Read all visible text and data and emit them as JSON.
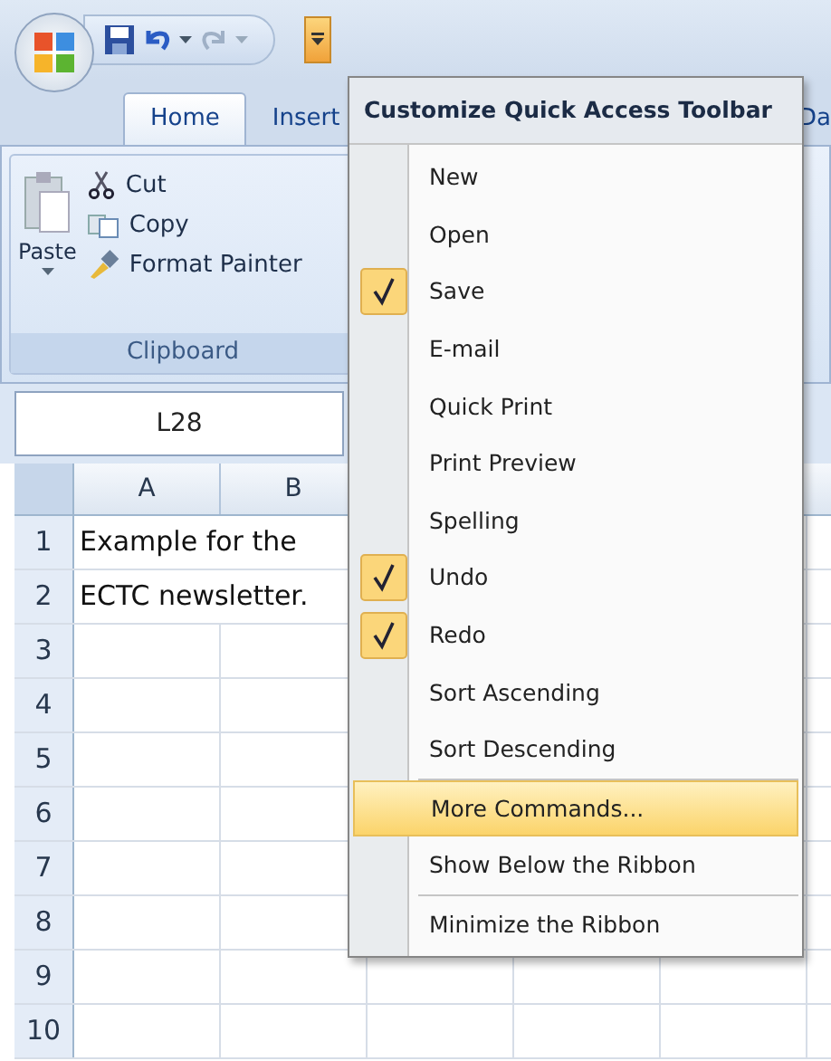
{
  "tabs": [
    {
      "label": "Home",
      "selected": true
    },
    {
      "label": "Insert",
      "selected": false
    },
    {
      "label": "Da",
      "selected": false
    }
  ],
  "clipboard": {
    "paste": "Paste",
    "commands": [
      {
        "kind": "cut",
        "label": "Cut"
      },
      {
        "kind": "copy",
        "label": "Copy"
      },
      {
        "kind": "painter",
        "label": "Format Painter"
      }
    ],
    "group": "Clipboard"
  },
  "name_box": "L28",
  "columns": [
    "A",
    "B"
  ],
  "rows": [
    {
      "number": "1",
      "cell": "Example for the"
    },
    {
      "number": "2",
      "cell": "ECTC newsletter."
    },
    {
      "number": "3"
    },
    {
      "number": "4"
    },
    {
      "number": "5"
    },
    {
      "number": "6"
    },
    {
      "number": "7"
    },
    {
      "number": "8"
    },
    {
      "number": "9"
    },
    {
      "number": "10"
    }
  ],
  "menu": {
    "title": "Customize Quick Access Toolbar",
    "items": [
      {
        "label": "New",
        "checked": false,
        "selected": false,
        "separator_before": false
      },
      {
        "label": "Open",
        "checked": false,
        "selected": false,
        "separator_before": false
      },
      {
        "label": "Save",
        "checked": true,
        "selected": false,
        "separator_before": false
      },
      {
        "label": "E-mail",
        "checked": false,
        "selected": false,
        "separator_before": false
      },
      {
        "label": "Quick Print",
        "checked": false,
        "selected": false,
        "separator_before": false
      },
      {
        "label": "Print Preview",
        "checked": false,
        "selected": false,
        "separator_before": false
      },
      {
        "label": "Spelling",
        "checked": false,
        "selected": false,
        "separator_before": false
      },
      {
        "label": "Undo",
        "checked": true,
        "selected": false,
        "separator_before": false
      },
      {
        "label": "Redo",
        "checked": true,
        "selected": false,
        "separator_before": false
      },
      {
        "label": "Sort Ascending",
        "checked": false,
        "selected": false,
        "separator_before": false
      },
      {
        "label": "Sort Descending",
        "checked": false,
        "selected": false,
        "separator_before": false
      },
      {
        "label": "More Commands...",
        "checked": false,
        "selected": true,
        "separator_before": true
      },
      {
        "label": "Show Below the Ribbon",
        "checked": false,
        "selected": false,
        "separator_before": false
      },
      {
        "label": "Minimize the Ribbon",
        "checked": false,
        "selected": false,
        "separator_before": true
      }
    ]
  }
}
